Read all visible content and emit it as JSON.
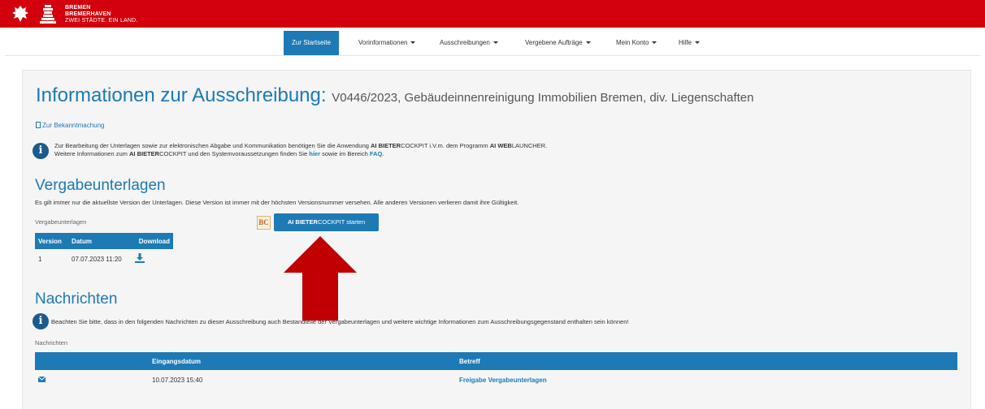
{
  "brand": {
    "line1": "BREMEN",
    "line2": "BREMERHAVEN",
    "tagline": "ZWEI STÄDTE. EIN LAND."
  },
  "nav": {
    "items": [
      {
        "label": "Zur Startseite",
        "active": true,
        "dropdown": false
      },
      {
        "label": "Vorinformationen",
        "active": false,
        "dropdown": true
      },
      {
        "label": "Ausschreibungen",
        "active": false,
        "dropdown": true
      },
      {
        "label": "Vergebene Aufträge",
        "active": false,
        "dropdown": true
      },
      {
        "label": "Mein Konto",
        "active": false,
        "dropdown": true
      },
      {
        "label": "Hilfe",
        "active": false,
        "dropdown": true
      }
    ]
  },
  "page": {
    "title": "Informationen zur Ausschreibung:",
    "subtitle": "V0446/2023, Gebäudeinnenreinigung Immobilien Bremen, div. Liegenschaften",
    "bekanntmachung_link": "Zur Bekanntmachung",
    "info": {
      "line1_a": "Zur Bearbeitung der Unterlagen sowie zur elektronischen Abgabe und Kommunikation benötigen Sie die Anwendung ",
      "line1_b": "AI BIETER",
      "line1_c": "COCKPIT i.V.m. dem Programm ",
      "line1_d": "AI WEB",
      "line1_e": "LAUNCHER.",
      "line2_a": "Weitere Informationen zum ",
      "line2_b": "AI BIETER",
      "line2_c": "COCKPIT und den Systemvoraussetzungen finden Sie ",
      "line2_link": "hier",
      "line2_d": " sowie im Bereich ",
      "line2_faq": "FAQ",
      "line2_e": "."
    }
  },
  "vergabe": {
    "heading": "Vergabeunterlagen",
    "note": "Es gilt immer nur die aktuellste Version der Unterlagen. Diese Version ist immer mit der höchsten Versionsnummer versehen. Alle anderen Versionen verlieren damit ihre Gültigkeit.",
    "table_caption": "Vergabeunterlagen",
    "columns": [
      "Version",
      "Datum",
      "Download"
    ],
    "rows": [
      {
        "version": "1",
        "datum": "07.07.2023 11:20"
      }
    ],
    "cockpit_logo": "BC",
    "start_prefix": "AI BIETER",
    "start_suffix": "COCKPIT starten"
  },
  "nachrichten": {
    "heading": "Nachrichten",
    "notice": "Beachten Sie bitte, dass in den folgenden Nachrichten zu dieser Ausschreibung auch Bestandteile der Vergabeunterlagen und weitere wichtige Informationen zum Ausschreibungsgegenstand enthalten sein können!",
    "table_caption": "Nachrichten",
    "columns": [
      "",
      "Eingangsdatum",
      "Betreff"
    ],
    "rows": [
      {
        "eingangsdatum": "10.07.2023 15:40",
        "betreff": "Freigabe Vergabeunterlagen"
      }
    ]
  },
  "colors": {
    "brand_red": "#d3010d",
    "accent_blue": "#1d7ab5",
    "arrow_red": "#c00000"
  },
  "icons": {
    "crest": "bremen-crest-icon",
    "key": "bremen-key-icon",
    "info": "info-icon",
    "download": "download-icon",
    "envelope": "envelope-icon",
    "document": "document-icon"
  }
}
